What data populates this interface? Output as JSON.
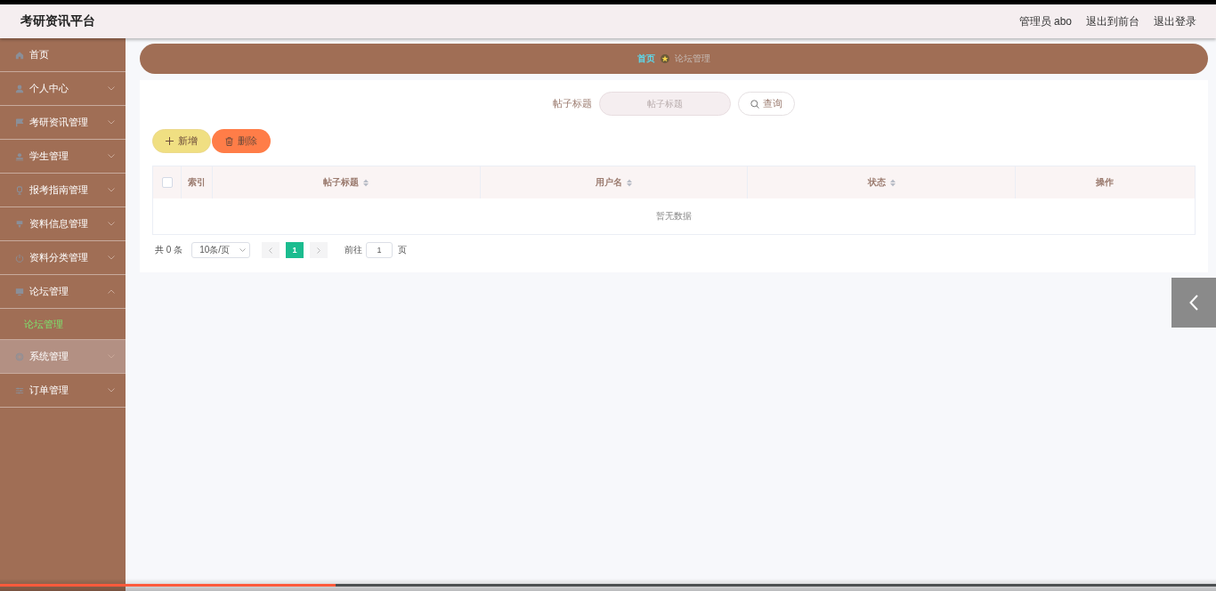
{
  "header": {
    "title": "考研资讯平台",
    "links": [
      "管理员 abo",
      "退出到前台",
      "退出登录"
    ]
  },
  "sidebar": {
    "items": [
      {
        "label": "首页",
        "kind": "link",
        "hovered": false
      },
      {
        "label": "个人中心",
        "kind": "group",
        "expanded": false,
        "hovered": false
      },
      {
        "label": "考研资讯管理",
        "kind": "group",
        "expanded": false,
        "hovered": false
      },
      {
        "label": "学生管理",
        "kind": "group",
        "expanded": false,
        "hovered": false
      },
      {
        "label": "报考指南管理",
        "kind": "group",
        "expanded": false,
        "hovered": false
      },
      {
        "label": "资料信息管理",
        "kind": "group",
        "expanded": false,
        "hovered": false
      },
      {
        "label": "资料分类管理",
        "kind": "group",
        "expanded": false,
        "hovered": false
      },
      {
        "label": "论坛管理",
        "kind": "group",
        "expanded": true,
        "hovered": false,
        "children": [
          {
            "label": "论坛管理",
            "selected": true
          }
        ]
      },
      {
        "label": "系统管理",
        "kind": "group",
        "expanded": false,
        "hovered": true
      },
      {
        "label": "订单管理",
        "kind": "group",
        "expanded": false,
        "hovered": false
      }
    ]
  },
  "breadcrumb": [
    "首页",
    "论坛管理"
  ],
  "search": {
    "label": "帖子标题",
    "placeholder": "帖子标题",
    "button": "查询"
  },
  "actions": [
    {
      "label": "新增",
      "kind": "add"
    },
    {
      "label": "删除",
      "kind": "delete"
    }
  ],
  "table": {
    "select_all_checked": false,
    "columns": [
      {
        "label": "索引",
        "sortable": false
      },
      {
        "label": "帖子标题",
        "sortable": true
      },
      {
        "label": "用户名",
        "sortable": true
      },
      {
        "label": "状态",
        "sortable": true
      },
      {
        "label": "操作",
        "sortable": false
      }
    ],
    "empty_text": "暂无数据"
  },
  "pagination": {
    "total": "共 0 条",
    "page_size": "10条/页",
    "pages": [
      {
        "label": "1",
        "selected": true
      }
    ],
    "goto_label": "前往",
    "goto_value": "1",
    "goto_suffix": "页"
  },
  "video_progress": {
    "level": 0.276
  }
}
